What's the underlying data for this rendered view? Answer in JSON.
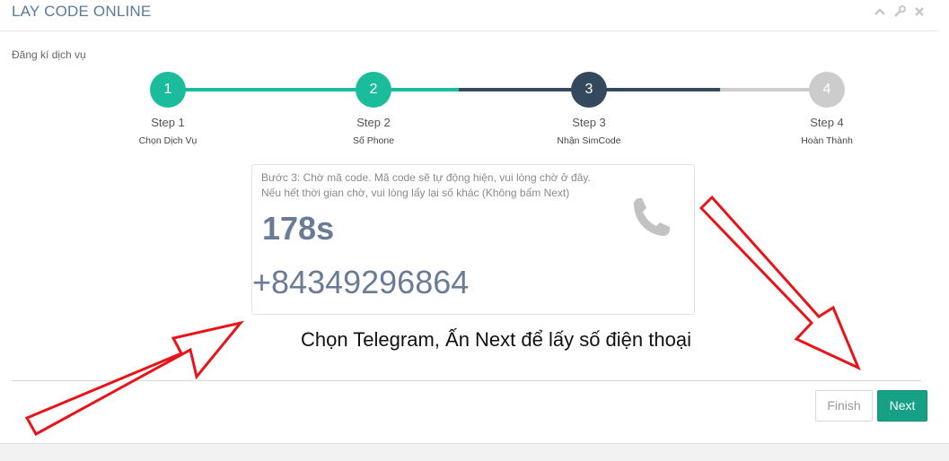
{
  "header": {
    "title": "LAY CODE ONLINE",
    "icons": [
      "chevron-up-icon",
      "wrench-icon",
      "close-icon"
    ]
  },
  "subtitle": "Đăng kí dịch vụ",
  "steps": [
    {
      "number": "1",
      "name": "Step 1",
      "sub": "Chọn Dịch Vụ",
      "state": "done"
    },
    {
      "number": "2",
      "name": "Step 2",
      "sub": "Số Phone",
      "state": "done"
    },
    {
      "number": "3",
      "name": "Step 3",
      "sub": "Nhận SimCode",
      "state": "current"
    },
    {
      "number": "4",
      "name": "Step 4",
      "sub": "Hoàn Thành",
      "state": "pending"
    }
  ],
  "card": {
    "line1": "Bước 3: Chờ mã code. Mã code sẽ tự động hiện, vui lòng chờ ở đây.",
    "line2": "Nếu hết thời gian chờ, vui lòng lấy lại số khác (Không bấm Next)",
    "timer": "178s",
    "phone": "+84349296864",
    "icon": "phone-icon"
  },
  "caption": "Chọn Telegram, Ấn Next để lấy số điện thoại",
  "buttons": {
    "finish": "Finish",
    "next": "Next"
  },
  "colors": {
    "green": "#1abc9c",
    "dark": "#34495e",
    "gray": "#cccccc",
    "next_button": "#16a085",
    "arrow": "#e8141a"
  }
}
